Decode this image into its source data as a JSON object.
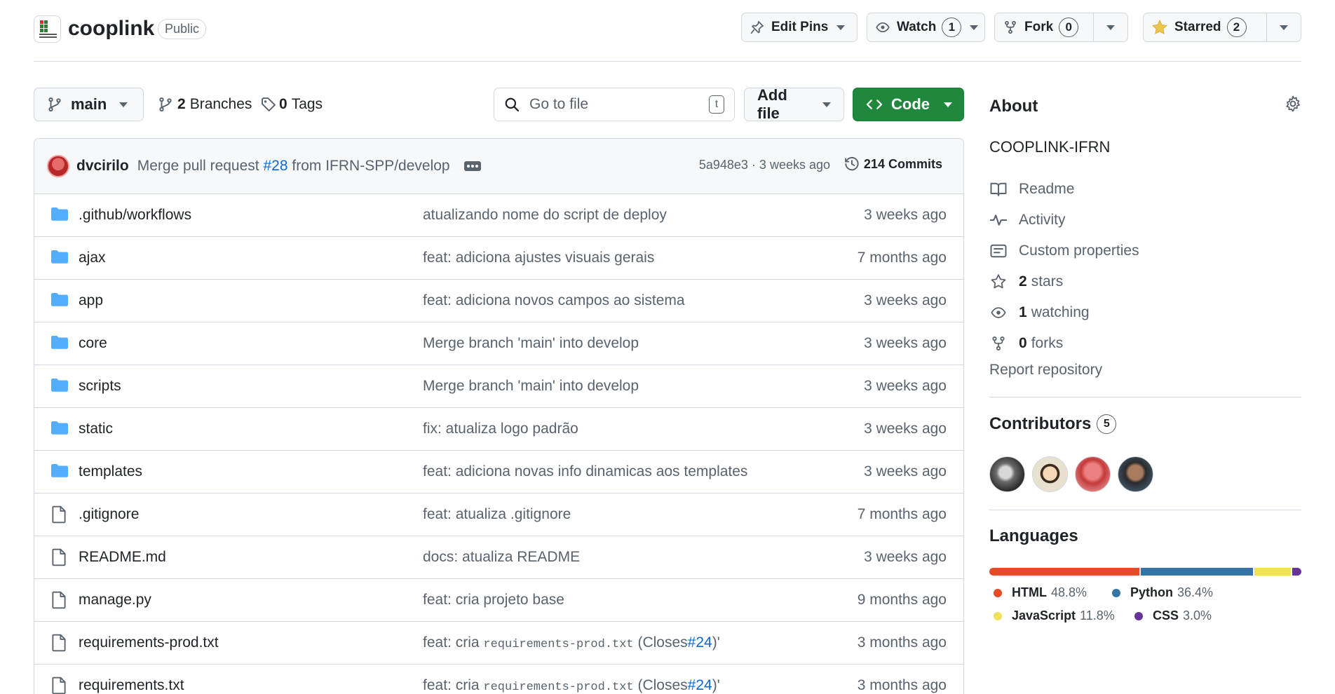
{
  "repo": {
    "name": "cooplink",
    "visibility": "Public",
    "logo_icon": "ifrn-logo"
  },
  "header_actions": {
    "edit_pins": "Edit Pins",
    "watch": {
      "label": "Watch",
      "count": "1"
    },
    "fork": {
      "label": "Fork",
      "count": "0"
    },
    "starred": {
      "label": "Starred",
      "count": "2",
      "star_color": "#eac54f"
    }
  },
  "toolbar": {
    "branch": "main",
    "branches_count": "2",
    "branches_label": "Branches",
    "tags_count": "0",
    "tags_label": "Tags",
    "search_placeholder": "Go to file",
    "search_shortcut": "t",
    "add_file": "Add file",
    "code": "Code",
    "code_color": "#1f883d"
  },
  "latest_commit": {
    "author": "dvcirilo",
    "message_prefix": "Merge pull request",
    "pr": "#28",
    "message_suffix": "from IFRN-SPP/develop",
    "hash_time": "5a948e3 · 3 weeks ago",
    "commits_count": "214",
    "commits_label": "Commits"
  },
  "files": [
    {
      "type": "folder",
      "name": ".github/workflows",
      "message": "atualizando nome do script de deploy",
      "time": "3 weeks ago"
    },
    {
      "type": "folder",
      "name": "ajax",
      "message": "feat: adiciona ajustes visuais gerais",
      "time": "7 months ago"
    },
    {
      "type": "folder",
      "name": "app",
      "message": "feat: adiciona novos campos ao sistema",
      "time": "3 weeks ago"
    },
    {
      "type": "folder",
      "name": "core",
      "message": "Merge branch 'main' into develop",
      "time": "3 weeks ago"
    },
    {
      "type": "folder",
      "name": "scripts",
      "message": "Merge branch 'main' into develop",
      "time": "3 weeks ago"
    },
    {
      "type": "folder",
      "name": "static",
      "message": "fix: atualiza logo padrão",
      "time": "3 weeks ago"
    },
    {
      "type": "folder",
      "name": "templates",
      "message": "feat: adiciona novas info dinamicas aos templates",
      "time": "3 weeks ago"
    },
    {
      "type": "file",
      "name": ".gitignore",
      "message": "feat: atualiza .gitignore",
      "time": "7 months ago"
    },
    {
      "type": "file",
      "name": "README.md",
      "message": "docs: atualiza README",
      "time": "3 weeks ago"
    },
    {
      "type": "file",
      "name": "manage.py",
      "message": "feat: cria projeto base",
      "time": "9 months ago"
    },
    {
      "type": "file",
      "name": "requirements-prod.txt",
      "message_prefix": "feat: cria",
      "message_code": "requirements-prod.txt",
      "message_mid": "(Closes",
      "message_link": "#24",
      "message_suffix": ")'",
      "time": "3 months ago"
    },
    {
      "type": "file",
      "name": "requirements.txt",
      "message_prefix": "feat: cria",
      "message_code": "requirements-prod.txt",
      "message_mid": "(Closes",
      "message_link": "#24",
      "message_suffix": ")'",
      "time": "3 months ago"
    }
  ],
  "about": {
    "title": "About",
    "description": "COOPLINK-IFRN",
    "items": [
      {
        "icon": "book-icon",
        "label": "Readme"
      },
      {
        "icon": "pulse-icon",
        "label": "Activity"
      },
      {
        "icon": "note-icon",
        "label": "Custom properties"
      },
      {
        "icon": "star-icon",
        "count": "2",
        "label": "stars"
      },
      {
        "icon": "eye-icon",
        "count": "1",
        "label": "watching"
      },
      {
        "icon": "fork-icon",
        "count": "0",
        "label": "forks"
      }
    ],
    "report": "Report repository"
  },
  "contributors": {
    "title": "Contributors",
    "count": "5"
  },
  "languages": {
    "title": "Languages",
    "items": [
      {
        "name": "HTML",
        "percent": "48.8%",
        "value": 48.8,
        "color": "#e34c26"
      },
      {
        "name": "Python",
        "percent": "36.4%",
        "value": 36.4,
        "color": "#3572a5"
      },
      {
        "name": "JavaScript",
        "percent": "11.8%",
        "value": 11.8,
        "color": "#f1e05a"
      },
      {
        "name": "CSS",
        "percent": "3.0%",
        "value": 3.0,
        "color": "#663399"
      }
    ]
  }
}
